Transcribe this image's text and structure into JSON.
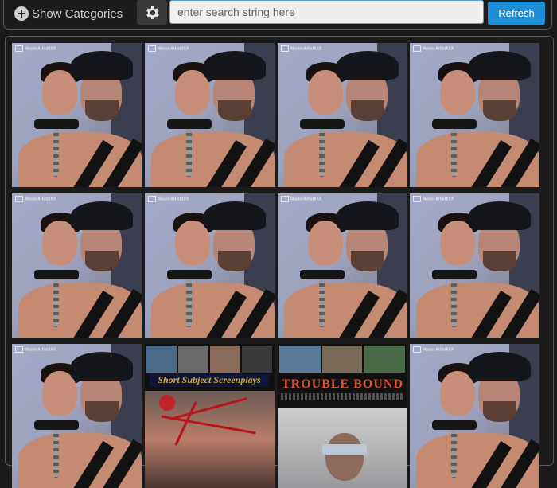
{
  "toolbar": {
    "show_categories_label": "Show Categories",
    "search_placeholder": "enter search string here",
    "search_value": "",
    "refresh_label": "Refresh"
  },
  "icons": {
    "categories": "plus-circle-icon",
    "settings": "gear-icon"
  },
  "colors": {
    "accent": "#1e8fd6",
    "background": "#1a1a1a",
    "banner_gold": "#d4a832",
    "banner_red": "#e7502c"
  },
  "gallery": {
    "watermark_text": "MasterArtistXXX",
    "banners": {
      "short_subject": "Short Subject Screenplays",
      "trouble_bound": "TROUBLE BOUND"
    }
  }
}
